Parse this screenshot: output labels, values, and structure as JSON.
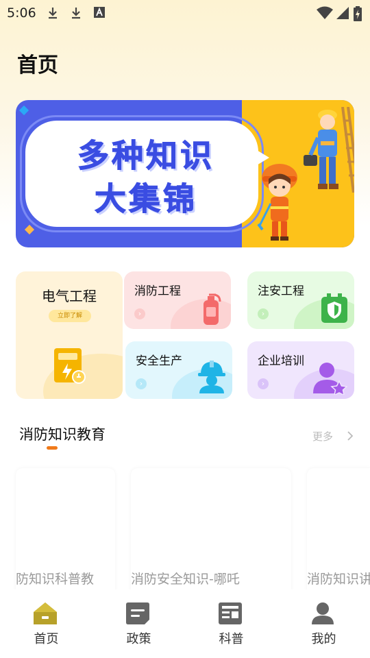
{
  "status_bar": {
    "time": "5:06"
  },
  "header": {
    "title": "首页"
  },
  "banner": {
    "line1": "多种知识",
    "line2": "大集锦"
  },
  "categories": {
    "big": {
      "label": "电气工程",
      "pill": "立即了解"
    },
    "cards": [
      {
        "label": "消防工程",
        "icon": "fire-extinguisher-icon"
      },
      {
        "label": "注安工程",
        "icon": "shield-battery-icon"
      },
      {
        "label": "安全生产",
        "icon": "hardhat-worker-icon"
      },
      {
        "label": "企业培训",
        "icon": "user-star-icon"
      }
    ]
  },
  "section": {
    "title": "消防知识教育",
    "more": "更多"
  },
  "videos": [
    {
      "title": "防知识科普教"
    },
    {
      "title": "消防安全知识-哪吒"
    },
    {
      "title": "消防知识讲"
    }
  ],
  "nav": [
    {
      "label": "首页",
      "icon": "home-icon",
      "active": true
    },
    {
      "label": "政策",
      "icon": "policy-icon"
    },
    {
      "label": "科普",
      "icon": "news-icon"
    },
    {
      "label": "我的",
      "icon": "profile-icon"
    }
  ],
  "colors": {
    "accent": "#f07a1a",
    "nav_active": "#b7a12a",
    "banner_blue": "#4e5fe6",
    "banner_yellow": "#fdc21a"
  }
}
